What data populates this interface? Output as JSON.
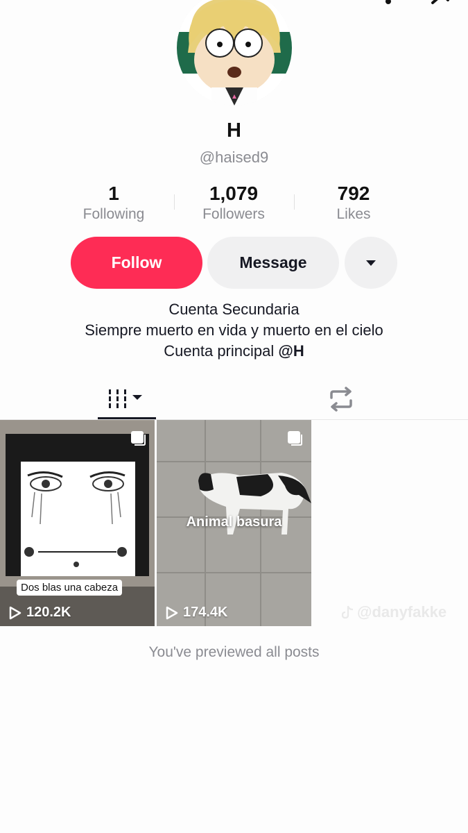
{
  "profile": {
    "display_name": "H",
    "username": "@haised9"
  },
  "stats": {
    "following": {
      "value": "1",
      "label": "Following"
    },
    "followers": {
      "value": "1,079",
      "label": "Followers"
    },
    "likes": {
      "value": "792",
      "label": "Likes"
    }
  },
  "actions": {
    "follow_label": "Follow",
    "message_label": "Message",
    "more_icon": "caret-down-icon"
  },
  "bio": {
    "line1": "Cuenta Secundaria",
    "line2": "Siempre muerto en vida y muerto en el cielo",
    "line3_prefix": "Cuenta principal ",
    "line3_mention": "@H"
  },
  "tabs": [
    {
      "icon": "grid-icon",
      "active": true
    },
    {
      "icon": "repost-icon",
      "active": false
    }
  ],
  "videos": [
    {
      "caption": "Dos blas una cabeza",
      "views": "120.2K"
    },
    {
      "caption": "Animal basura",
      "views": "174.4K"
    }
  ],
  "watermark": "@danyfakke",
  "footer": {
    "end_text": "You've previewed all posts"
  },
  "colors": {
    "follow": "#fe2c55",
    "secondary_button": "#f0f0f1",
    "muted_text": "#8a8b91"
  }
}
